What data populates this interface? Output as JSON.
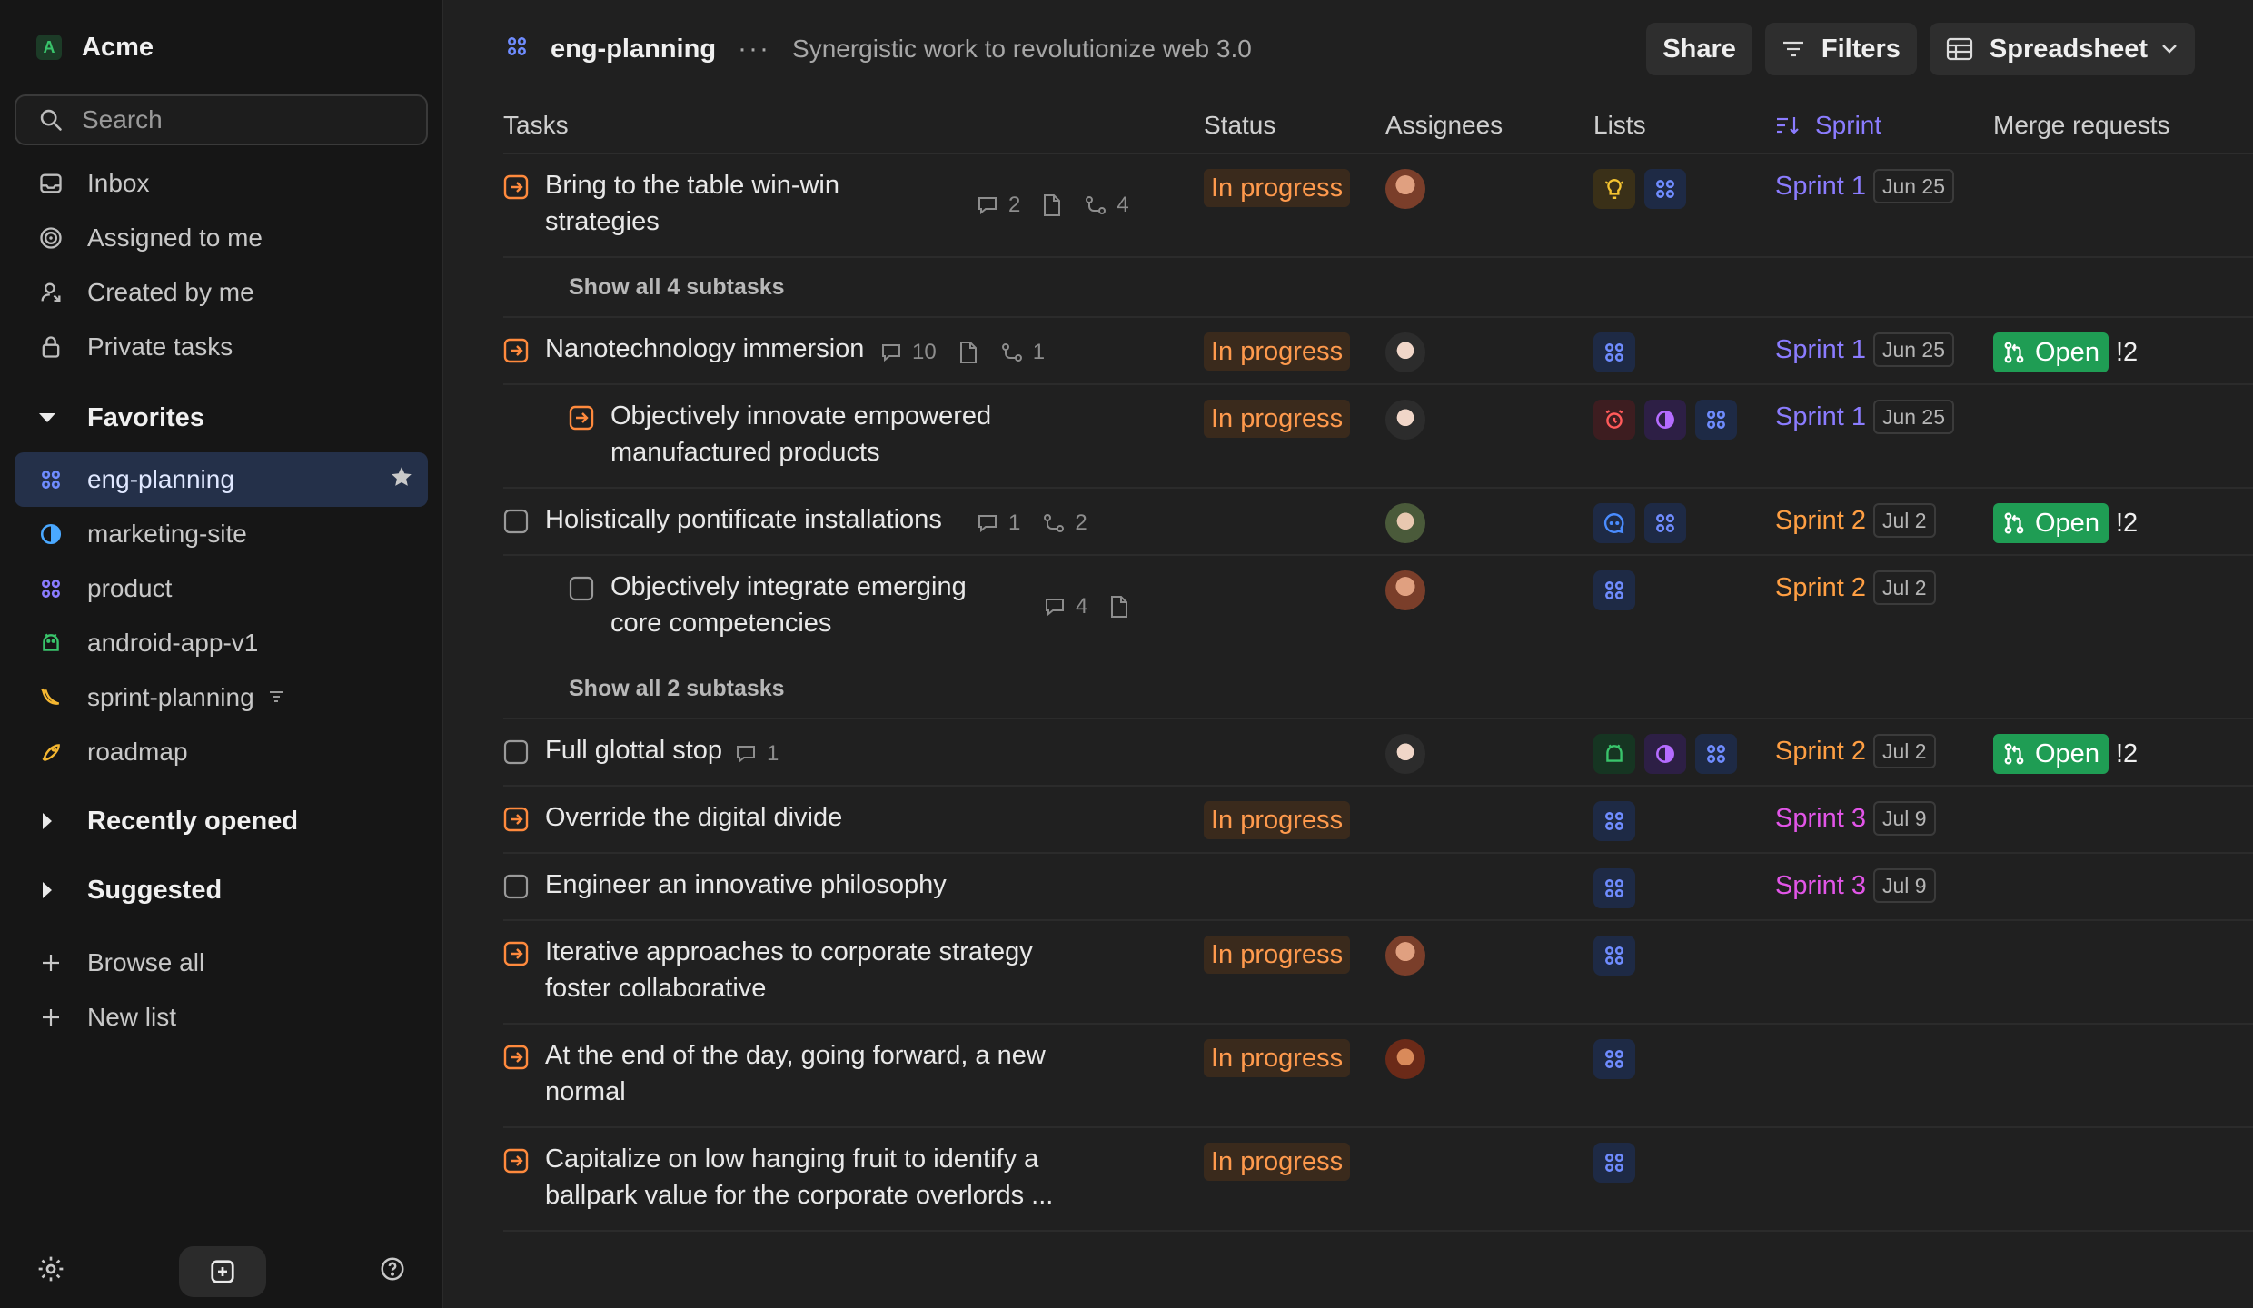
{
  "workspace": {
    "initial": "A",
    "name": "Acme"
  },
  "search": {
    "placeholder": "Search"
  },
  "nav": [
    {
      "label": "Inbox",
      "icon": "inbox-icon"
    },
    {
      "label": "Assigned to me",
      "icon": "target-icon"
    },
    {
      "label": "Created by me",
      "icon": "user-icon"
    },
    {
      "label": "Private tasks",
      "icon": "lock-icon"
    }
  ],
  "favorites": {
    "title": "Favorites",
    "items": [
      {
        "label": "eng-planning",
        "icon": "grid-icon",
        "color": "#6f8cff",
        "active": true
      },
      {
        "label": "marketing-site",
        "icon": "half-circle-icon",
        "color": "#4aa8ff"
      },
      {
        "label": "product",
        "icon": "grid-icon",
        "color": "#8b7cff"
      },
      {
        "label": "android-app-v1",
        "icon": "android-icon",
        "color": "#39c46b"
      },
      {
        "label": "sprint-planning",
        "icon": "banana-icon",
        "color": "#f5b731"
      },
      {
        "label": "roadmap",
        "icon": "rocket-icon",
        "color": "#f5b731"
      }
    ]
  },
  "sections": {
    "recent": "Recently opened",
    "suggested": "Suggested"
  },
  "actions": {
    "browse": "Browse all",
    "new_list": "New list"
  },
  "header": {
    "title": "eng-planning",
    "description": "Synergistic work to revolutionize web 3.0",
    "share": "Share",
    "filters": "Filters",
    "view": "Spreadsheet"
  },
  "columns": {
    "tasks": "Tasks",
    "status": "Status",
    "assignees": "Assignees",
    "lists": "Lists",
    "sprint": "Sprint",
    "merge": "Merge requests"
  },
  "status_label": "In progress",
  "mr_label": "Open",
  "mr_number": "!2",
  "colors": {
    "sprint1": "#8b7cff",
    "sprint2": "#ff9f43",
    "sprint3": "#e255e8",
    "status": "#ff9a4d"
  },
  "rows": [
    {
      "title_1": "Bring to the table win-win",
      "title_2": "strategies",
      "comments": "2",
      "subtasks": "4",
      "sprint": "Sprint 1",
      "date": "Jun 25"
    },
    {
      "show_all": "Show all 4 subtasks"
    },
    {
      "title_1": "Nanotechnology immersion",
      "comments": "10",
      "subtasks": "1",
      "sprint": "Sprint 1",
      "date": "Jun 25"
    },
    {
      "title_1": "Objectively innovate empowered",
      "title_2": "manufactured products",
      "sprint": "Sprint 1",
      "date": "Jun 25"
    },
    {
      "title_1": "Holistically pontificate installations",
      "comments": "1",
      "subtasks": "2",
      "sprint": "Sprint 2",
      "date": "Jul 2"
    },
    {
      "title_1": "Objectively integrate emerging",
      "title_2": "core competencies",
      "comments": "4",
      "sprint": "Sprint 2",
      "date": "Jul 2"
    },
    {
      "show_all": "Show all 2 subtasks"
    },
    {
      "title_1": "Full glottal stop",
      "comments": "1",
      "sprint": "Sprint 2",
      "date": "Jul 2"
    },
    {
      "title_1": "Override the digital divide",
      "sprint": "Sprint 3",
      "date": "Jul 9"
    },
    {
      "title_1": "Engineer an innovative philosophy",
      "sprint": "Sprint 3",
      "date": "Jul 9"
    },
    {
      "title_1": "Iterative approaches to corporate strategy",
      "title_2": "foster collaborative"
    },
    {
      "title_1": "At the end of the day, going forward, a new",
      "title_2": "normal"
    },
    {
      "title_1": "Capitalize on low hanging fruit to identify a",
      "title_2": "ballpark value for the corporate overlords ..."
    }
  ]
}
